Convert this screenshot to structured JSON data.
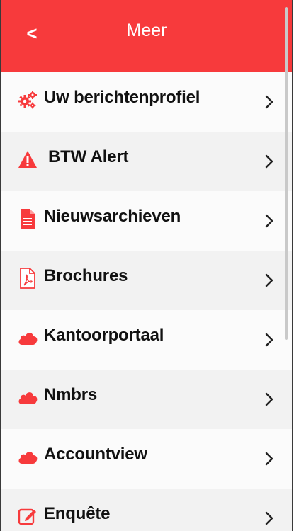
{
  "header": {
    "back_label": "<",
    "title": "Meer"
  },
  "menu": {
    "items": [
      {
        "label": "Uw berichtenprofiel",
        "icon": "gears-icon"
      },
      {
        "label": "BTW Alert",
        "icon": "warning-icon"
      },
      {
        "label": "Nieuwsarchieven",
        "icon": "document-icon"
      },
      {
        "label": "Brochures",
        "icon": "pdf-icon"
      },
      {
        "label": "Kantoorportaal",
        "icon": "cloud-icon"
      },
      {
        "label": "Nmbrs",
        "icon": "cloud-icon"
      },
      {
        "label": "Accountview",
        "icon": "cloud-icon"
      },
      {
        "label": "Enquête",
        "icon": "edit-icon"
      }
    ]
  },
  "colors": {
    "accent": "#f73a3c",
    "row_alt": "#f2f2f2",
    "text": "#111111"
  }
}
